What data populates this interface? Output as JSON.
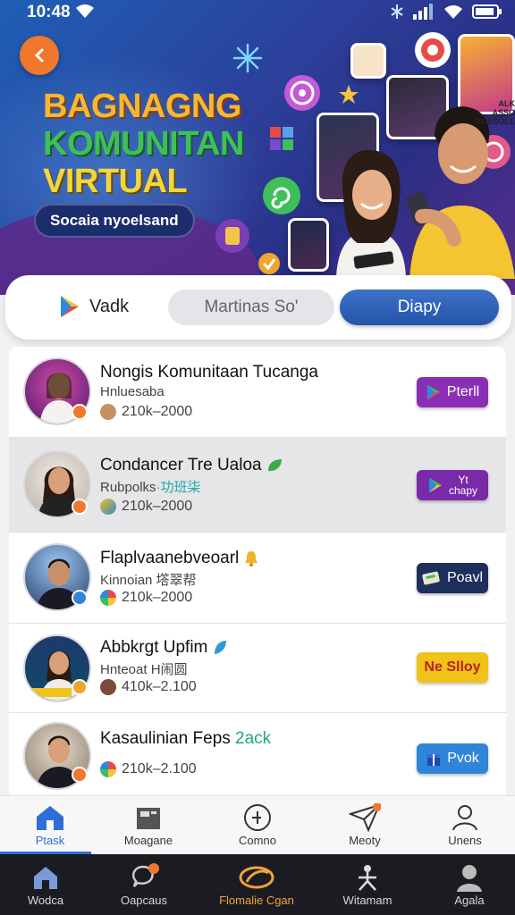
{
  "status_bar": {
    "time": "10:48"
  },
  "hero": {
    "title_line1": "BAGNAGNG",
    "title_line2": "KOMUNITAN",
    "title_line3": "VIRTUAL",
    "pill_text": "Socaia nyoelsand",
    "card_caption_top_right": "ALK ASSO",
    "card_caption_sub": "BOSSOLE"
  },
  "tabs": {
    "play_label": "Vadk",
    "middle_label": "Martinas So'",
    "right_label": "Diapy"
  },
  "list": [
    {
      "title": "Nongis Komunitaan Tucanga",
      "sub": "Hnluesaba",
      "stat": "210k–2000",
      "button": "Pterll",
      "button_color": "#8a2fb5"
    },
    {
      "title": "Condancer Tre Ualoa",
      "sub": "Rubpolks",
      "sub_accent": "·功班柒",
      "stat": "210k–2000",
      "button": "Yt\nchapy",
      "button_color": "#7a2aa8"
    },
    {
      "title": "Flaplvaanebveoarl",
      "sub": "Kinnoian 㙮翠帮",
      "stat": "210k–2000",
      "button": "Poavl",
      "button_color": "#1e2f5c"
    },
    {
      "title": "Abbkrgt Upfim",
      "sub": "Hnteoat H闹圆",
      "stat": "410k–2.100",
      "button": "Ne Slloy",
      "button_color": "#f0c21a"
    },
    {
      "title": "Kasaulinian Feps",
      "title_accent": "2ack",
      "sub": "",
      "stat": "210k–2.100",
      "button": "Pvok",
      "button_color": "#2f86d8"
    }
  ],
  "nav_primary": [
    {
      "label": "Ptask",
      "icon": "home-icon",
      "active": true
    },
    {
      "label": "Moagane",
      "icon": "folder-icon"
    },
    {
      "label": "Comno",
      "icon": "compass-icon"
    },
    {
      "label": "Meoty",
      "icon": "send-icon"
    },
    {
      "label": "Unens",
      "icon": "user-icon"
    }
  ],
  "nav_secondary": [
    {
      "label": "Wodca",
      "icon": "home-icon"
    },
    {
      "label": "Oapcaus",
      "icon": "chat-icon"
    },
    {
      "label": "Flomalie Cgan",
      "icon": "game-icon",
      "highlight": true
    },
    {
      "label": "Witamam",
      "icon": "person-icon"
    },
    {
      "label": "Agala",
      "icon": "profile-icon"
    }
  ],
  "colors": {
    "accent": "#2d6fd6",
    "orange": "#f0772c",
    "highlight_text": "#f2a23a"
  }
}
